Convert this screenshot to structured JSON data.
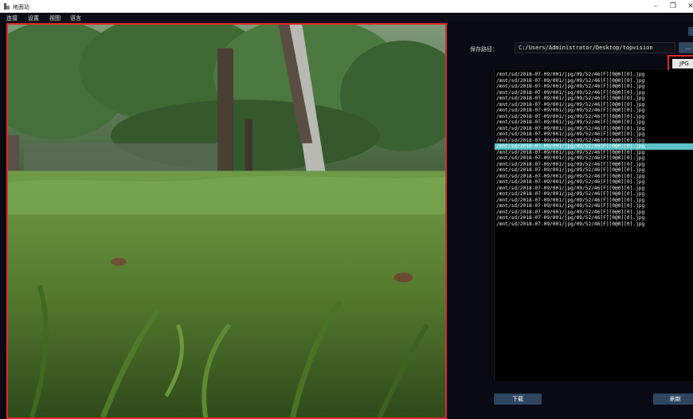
{
  "window": {
    "title": "地面站",
    "minimize": "–",
    "maximize": "❐",
    "close": "✕"
  },
  "menu": {
    "items": [
      "连接",
      "设置",
      "视图",
      "语言"
    ]
  },
  "preview": {
    "icon": "camera-preview"
  },
  "save": {
    "label": "保存路径：",
    "path": "C:/Users/Administrator/Desktop/topvision",
    "browse_label": "..."
  },
  "format": {
    "value": "JPG"
  },
  "files": {
    "selected_index": 12,
    "items": [
      "/mnt/sd/2018-07-09/001/jpg/09/52/46[F][0@0][0].jpg",
      "/mnt/sd/2018-07-09/001/jpg/09/52/46[F][0@0][0].jpg",
      "/mnt/sd/2018-07-09/001/jpg/09/52/46[F][0@0][0].jpg",
      "/mnt/sd/2018-07-09/001/jpg/09/52/46[F][0@0][0].jpg",
      "/mnt/sd/2018-07-09/001/jpg/09/52/46[F][0@0][0].jpg",
      "/mnt/sd/2018-07-09/001/jpg/09/52/46[F][0@0][0].jpg",
      "/mnt/sd/2018-07-09/001/jpg/09/52/46[F][0@0][0].jpg",
      "/mnt/sd/2018-07-09/001/jpg/09/52/46[F][0@0][0].jpg",
      "/mnt/sd/2018-07-09/001/jpg/09/52/46[F][0@0][0].jpg",
      "/mnt/sd/2018-07-09/001/jpg/09/52/46[F][0@0][0].jpg",
      "/mnt/sd/2018-07-09/001/jpg/09/52/46[F][0@0][0].jpg",
      "/mnt/sd/2018-07-09/001/jpg/09/52/46[F][0@0][0].jpg",
      "/mnt/sd/2018-07-09/001/jpg/09/52/46[F][0@0][0].jpg",
      "/mnt/sd/2018-07-09/001/jpg/09/52/46[F][0@0][0].jpg",
      "/mnt/sd/2018-07-09/001/jpg/09/52/46[F][0@0][0].jpg",
      "/mnt/sd/2018-07-09/001/jpg/09/52/46[F][0@0][0].jpg",
      "/mnt/sd/2018-07-09/001/jpg/09/52/46[F][0@0][0].jpg",
      "/mnt/sd/2018-07-09/001/jpg/09/52/46[F][0@0][0].jpg",
      "/mnt/sd/2018-07-09/001/jpg/09/52/46[F][0@0][0].jpg",
      "/mnt/sd/2018-07-09/001/jpg/09/52/46[F][0@0][0].jpg",
      "/mnt/sd/2018-07-09/001/jpg/09/52/46[F][0@0][0].jpg",
      "/mnt/sd/2018-07-09/001/jpg/09/52/46[F][0@0][0].jpg",
      "/mnt/sd/2018-07-09/001/jpg/09/52/46[F][0@0][0].jpg",
      "/mnt/sd/2018-07-09/001/jpg/09/52/46[F][0@0][0].jpg",
      "/mnt/sd/2018-07-09/001/jpg/09/52/46[F][0@0][0].jpg",
      "/mnt/sd/2018-07-09/001/jpg/09/52/46[F][0@0][0].jpg"
    ]
  },
  "actions": {
    "download_label": "下载",
    "refresh_label": "刷新"
  },
  "colors": {
    "highlight": "#e12b2b",
    "selected_row": "#5ec3c9",
    "button": "#2f4660",
    "background": "#0a0a14"
  }
}
